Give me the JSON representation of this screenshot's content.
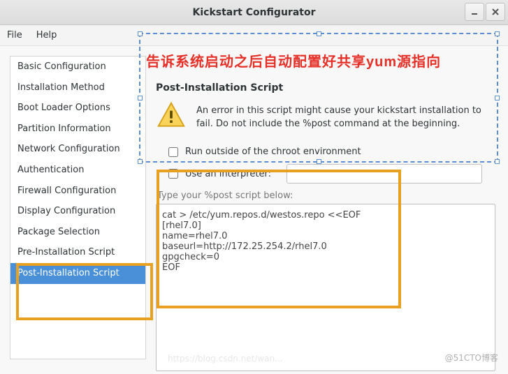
{
  "window": {
    "title": "Kickstart Configurator"
  },
  "menubar": {
    "file": "File",
    "help": "Help"
  },
  "sidebar": {
    "items": [
      {
        "label": "Basic Configuration"
      },
      {
        "label": "Installation Method"
      },
      {
        "label": "Boot Loader Options"
      },
      {
        "label": "Partition Information"
      },
      {
        "label": "Network Configuration"
      },
      {
        "label": "Authentication"
      },
      {
        "label": "Firewall Configuration"
      },
      {
        "label": "Display Configuration"
      },
      {
        "label": "Package Selection"
      },
      {
        "label": "Pre-Installation Script"
      },
      {
        "label": "Post-Installation Script",
        "selected": true
      }
    ]
  },
  "annotation": {
    "text": "告诉系统启动之后自动配置好共享yum源指向"
  },
  "panel": {
    "title": "Post-Installation Script",
    "warning": "An error in this script might cause your kickstart installation to fail. Do not include the %post command at the beginning.",
    "chroot_label": "Run outside of the chroot environment",
    "interpreter_label": "Use an interpreter:",
    "interpreter_value": "",
    "script_label": "Type your %post script below:",
    "script_value": "cat > /etc/yum.repos.d/westos.repo <<EOF\n[rhel7.0]\nname=rhel7.0\nbaseurl=http://172.25.254.2/rhel7.0\ngpgcheck=0\nEOF"
  },
  "footer": {
    "watermark": "@51CTO博客",
    "faded": "https://blog.csdn.net/wan..."
  }
}
